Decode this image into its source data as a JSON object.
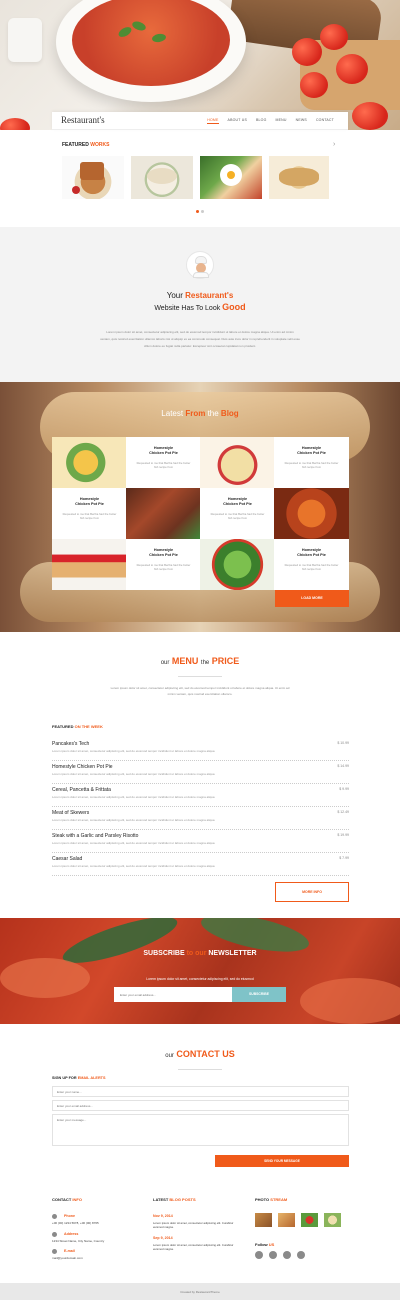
{
  "nav": {
    "logo": "Restaurant's",
    "items": [
      "HOME",
      "ABOUT US",
      "BLOG",
      "MENU",
      "NEWS",
      "CONTACT"
    ]
  },
  "featured": {
    "title_a": "FEATURED",
    "title_b": "WORKS",
    "next_icon": "chevron-right-icon"
  },
  "intro": {
    "line1_a": "Your",
    "line1_b": "Restaurant's",
    "line2_a": "Website Has To Look",
    "line2_b": "Good",
    "text1": "Lorem ipsum dolor sit amet, consectetur adipiscing elit, sed do eiusmod tempor incididunt ut labore et dolore magna aliqua. Ut enim ad minim",
    "text2": "veniam, quis nostrud exercitation ullamco laboris nisi ut aliquip ex ea commodo consequat. Duis aute irure dolor in reprehenderit in voluptate velit esse",
    "text3": "cillum dolore eu fugiat nulla pariatur. Excepteur sint occaecat cupidatat non proident."
  },
  "blog": {
    "title_a": "Latest",
    "title_b": "From",
    "title_c": "the",
    "title_d": "Blog",
    "card_title_1": "Homestyle",
    "card_title_2": "Chicken Pot Pie",
    "card_text": "Requested to me that Bertha had the butter fish recipe from",
    "load_more": "LOAD MORE"
  },
  "menu": {
    "title_a": "our",
    "title_b": "MENU",
    "title_c": "the",
    "title_d": "PRICE",
    "intro1": "Lorem ipsum dolor sit amet, consectetur adipiscing elit, sed do eiusmod tempor incididunt ut labore et dolore magna aliqua. Ut enim ad",
    "intro2": "minim veniam, quis nostrud exercitation ullamco.",
    "featured_a": "FEATURED",
    "featured_b": "ON THE WEEK",
    "desc": "Lorem ipsum dolor sit amet, consectetur adipiscing elit, sed do eiusmod tempor incididunt ut labore et dolore magna aliqua",
    "items": [
      {
        "name": "Pancakes's Tech",
        "price": "$ 10.99"
      },
      {
        "name": "Homestyle Chicken Pot Pie",
        "price": "$ 14.99"
      },
      {
        "name": "Cereal, Pancetta & Frittata",
        "price": "$ 9.99"
      },
      {
        "name": "Meat of Skewers",
        "price": "$ 12.49"
      },
      {
        "name": "Steak with a Garlic and Parsley Risotto",
        "price": "$ 19.99"
      },
      {
        "name": "Caesar Salad",
        "price": "$ 7.99"
      }
    ],
    "more": "MORE INFO"
  },
  "subscribe": {
    "title_a": "SUBSCRIBE",
    "title_b": "to",
    "title_c": "our",
    "title_d": "NEWSLETTER",
    "text": "Lorem ipsum dolor sit amet, consectetur adipiscing elit, sed do eiusmod",
    "placeholder": "Enter your email address...",
    "button": "SUBSCRIBE"
  },
  "contact": {
    "title_a": "our",
    "title_b": "CONTACT US",
    "signup_a": "SIGN UP FOR",
    "signup_b": "EMAIL ALERTS",
    "name_ph": "Enter your name...",
    "email_ph": "Enter your email address...",
    "msg_ph": "Enter your message...",
    "send": "SEND YOUR MESSAGE"
  },
  "footer": {
    "contact_a": "CONTACT",
    "contact_b": "INFO",
    "phone_label": "Phone",
    "phone": "+00 (00) 1234 5678, +00 (00) 8765",
    "address_label": "Address",
    "address": "1234 Street Name, City Name, Country",
    "email_label": "E-mail",
    "email": "mail@yourdomain.com",
    "latest_a": "LATEST",
    "latest_b": "BLOG POSTS",
    "posts": [
      {
        "date": "Nov 9, 2014",
        "text": "Lorem ipsum dolor sit amet, consectetur adipiscing elit. Curabitur euismod magna."
      },
      {
        "date": "Sep 9, 2014",
        "text": "Lorem ipsum dolor sit amet, consectetur adipiscing elit. Curabitur euismod magna."
      }
    ],
    "photo_a": "PHOTO",
    "photo_b": "STREAM",
    "follow_a": "Follow",
    "follow_b": "US",
    "social": [
      "facebook-icon",
      "twitter-icon",
      "instagram-icon",
      "youtube-icon"
    ],
    "copyright": "Created by RestaurantTheme"
  },
  "colors": {
    "accent": "#f05a1a",
    "sub_button": "#7fc3c8"
  }
}
